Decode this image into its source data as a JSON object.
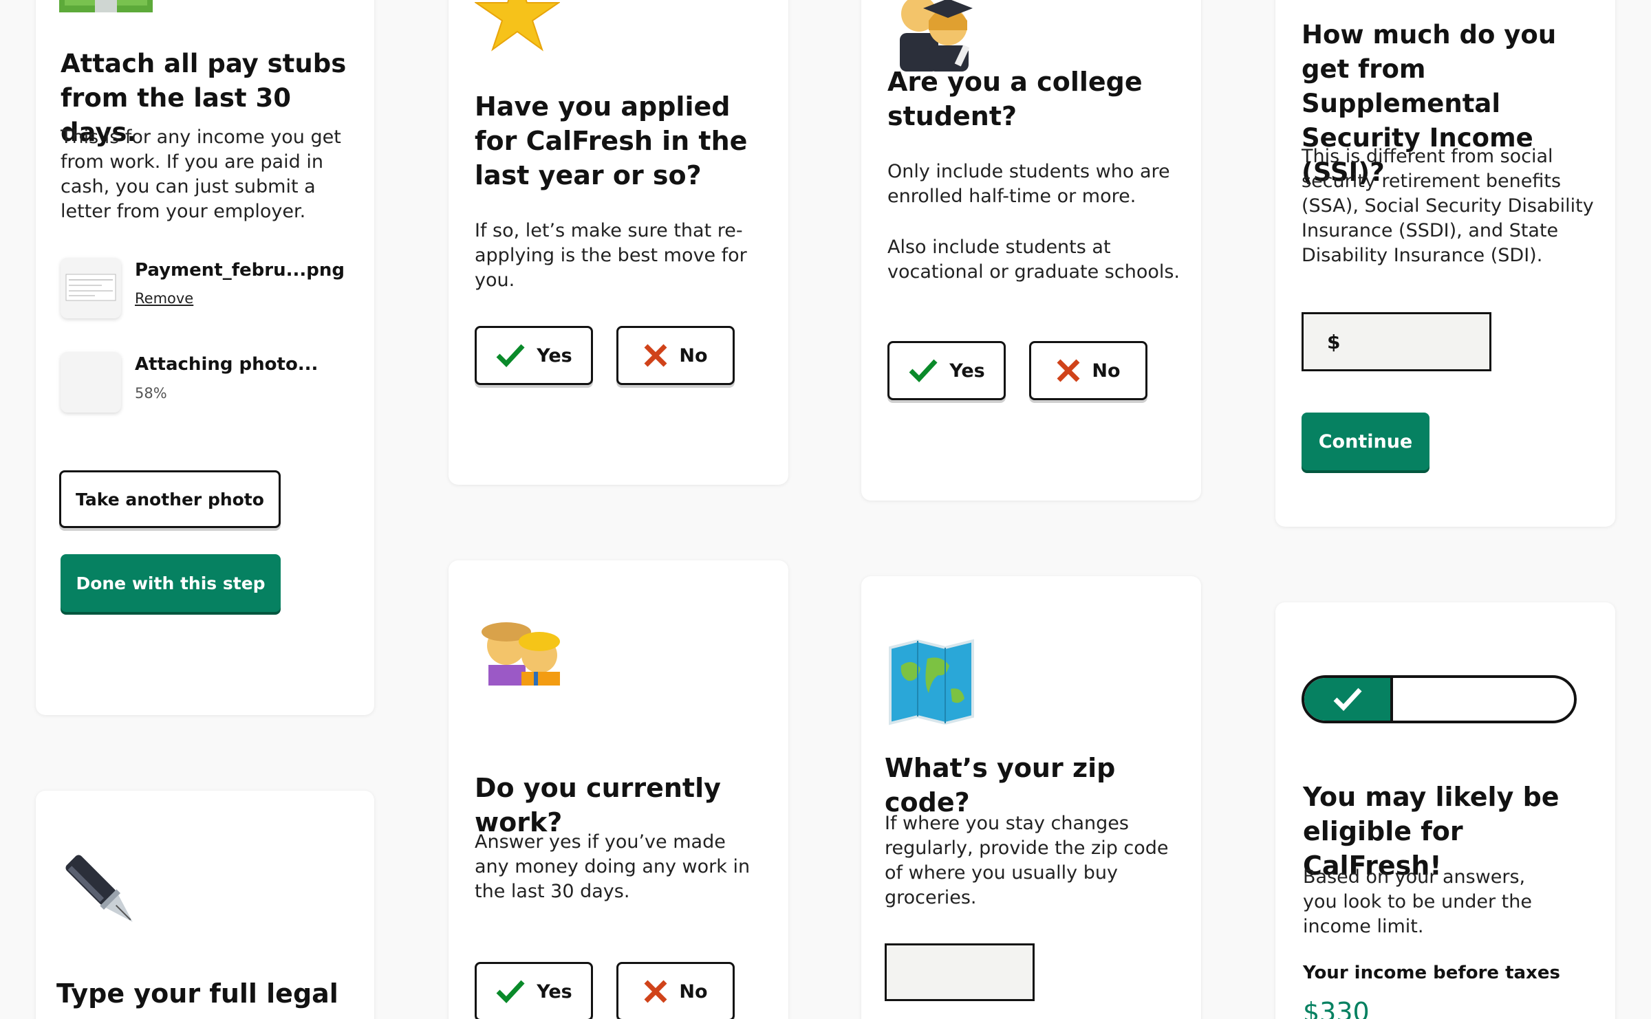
{
  "colors": {
    "brand_green": "#068161",
    "check_green": "#0a8a2a",
    "x_red": "#d0431a",
    "text": "#121212"
  },
  "card_paystubs": {
    "icon": "money-icon",
    "title": "Attach all pay stubs from the last 30 days.",
    "description": "This is for any income you get from work. If you are paid in cash, you can just submit a letter from your employer.",
    "files": [
      {
        "name": "Payment_febru...png",
        "action": "Remove"
      },
      {
        "name": "Attaching photo...",
        "progress": "58%"
      }
    ],
    "take_photo_label": "Take another photo",
    "done_label": "Done with this step"
  },
  "card_signature": {
    "icon": "fountain-pen-icon",
    "title": "Type your full legal"
  },
  "card_applied": {
    "icon": "star-icon",
    "title": "Have you applied for CalFresh in the last year or so?",
    "description": "If so, let’s make sure that re-applying is the best move for you.",
    "yes_label": "Yes",
    "no_label": "No"
  },
  "card_work": {
    "icon": "workers-icon",
    "title": "Do you currently work?",
    "description": "Answer yes if you’ve made any money doing any work in the last 30 days.",
    "yes_label": "Yes",
    "no_label": "No"
  },
  "card_student": {
    "icon": "graduates-icon",
    "title": "Are you a college student?",
    "description1": "Only include students who are enrolled half-time or more.",
    "description2": "Also include students at vocational or graduate schools.",
    "yes_label": "Yes",
    "no_label": "No"
  },
  "card_zip": {
    "icon": "world-map-icon",
    "title": "What’s your zip code?",
    "description": "If where you stay changes regularly, provide the zip code of where you usually buy groceries.",
    "input_value": ""
  },
  "card_ssi": {
    "title": "How much do you get from Supplemental Security Income (SSI)?",
    "description": "This is different from social security retirement benefits (SSA), Social Security Disability Insurance (SSDI), and State Disability Insurance (SDI).",
    "currency_prefix": "$",
    "input_value": "",
    "continue_label": "Continue"
  },
  "card_eligible": {
    "progress_fraction": 0.33,
    "title": "You may likely be eligible for CalFresh!",
    "description": "Based on your answers, you look to be under the income limit.",
    "income_label": "Your income before taxes",
    "income_value": "$330"
  }
}
